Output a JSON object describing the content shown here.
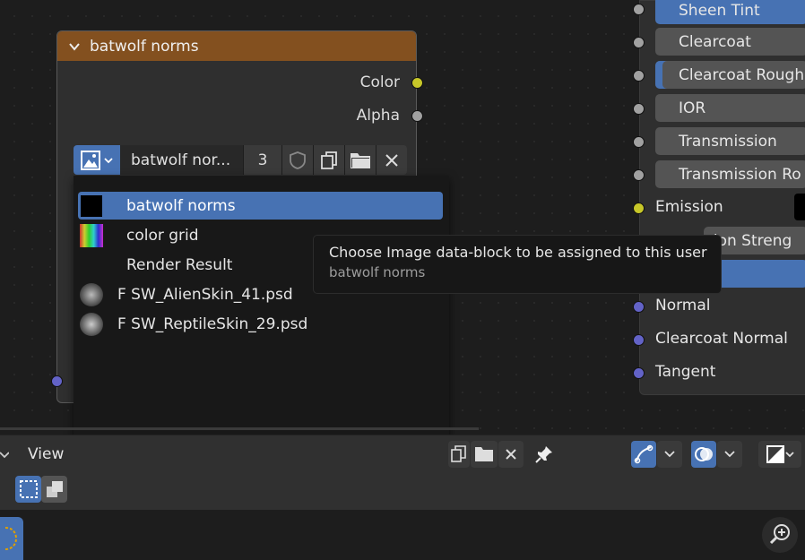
{
  "node": {
    "title": "batwolf norms",
    "outputs": [
      {
        "label": "Color",
        "color": "#c7c729"
      },
      {
        "label": "Alpha",
        "color": "#a1a1a1"
      }
    ],
    "image": {
      "name": "batwolf nor...",
      "users": "3"
    }
  },
  "dropdown": {
    "items": [
      {
        "label": "batwolf norms",
        "active": true,
        "thumb": "black-swatch"
      },
      {
        "label": "color grid",
        "active": false,
        "thumb": "color-grid"
      },
      {
        "label": "Render Result",
        "active": false,
        "thumb": "none"
      },
      {
        "label": "F SW_AlienSkin_41.psd",
        "active": false,
        "thumb": "alien-skin"
      },
      {
        "label": "F SW_ReptileSkin_29.psd",
        "active": false,
        "thumb": "reptile-skin"
      }
    ],
    "search_value": ""
  },
  "tooltip": {
    "title": "Choose Image data-block to be assigned to this user",
    "subtitle": "batwolf norms"
  },
  "bsdf": {
    "fields": [
      {
        "label": "Sheen Tint",
        "style": "blue"
      },
      {
        "label": "Clearcoat",
        "style": "plain"
      },
      {
        "label": "Clearcoat Rough",
        "style": "partial"
      },
      {
        "label": "IOR",
        "style": "plain"
      },
      {
        "label": "Transmission",
        "style": "plain"
      },
      {
        "label": "Transmission Ro",
        "style": "plain"
      }
    ],
    "emission_label": "Emission",
    "emission_strength_label": "sion Streng",
    "vector_inputs": [
      "Normal",
      "Clearcoat Normal",
      "Tangent"
    ]
  },
  "header": {
    "view_menu": "View"
  },
  "colors": {
    "accent": "#4772b3",
    "node_header": "#83501f",
    "color_socket": "#c7c729",
    "vector_socket": "#6363c7",
    "float_socket": "#a1a1a1"
  }
}
